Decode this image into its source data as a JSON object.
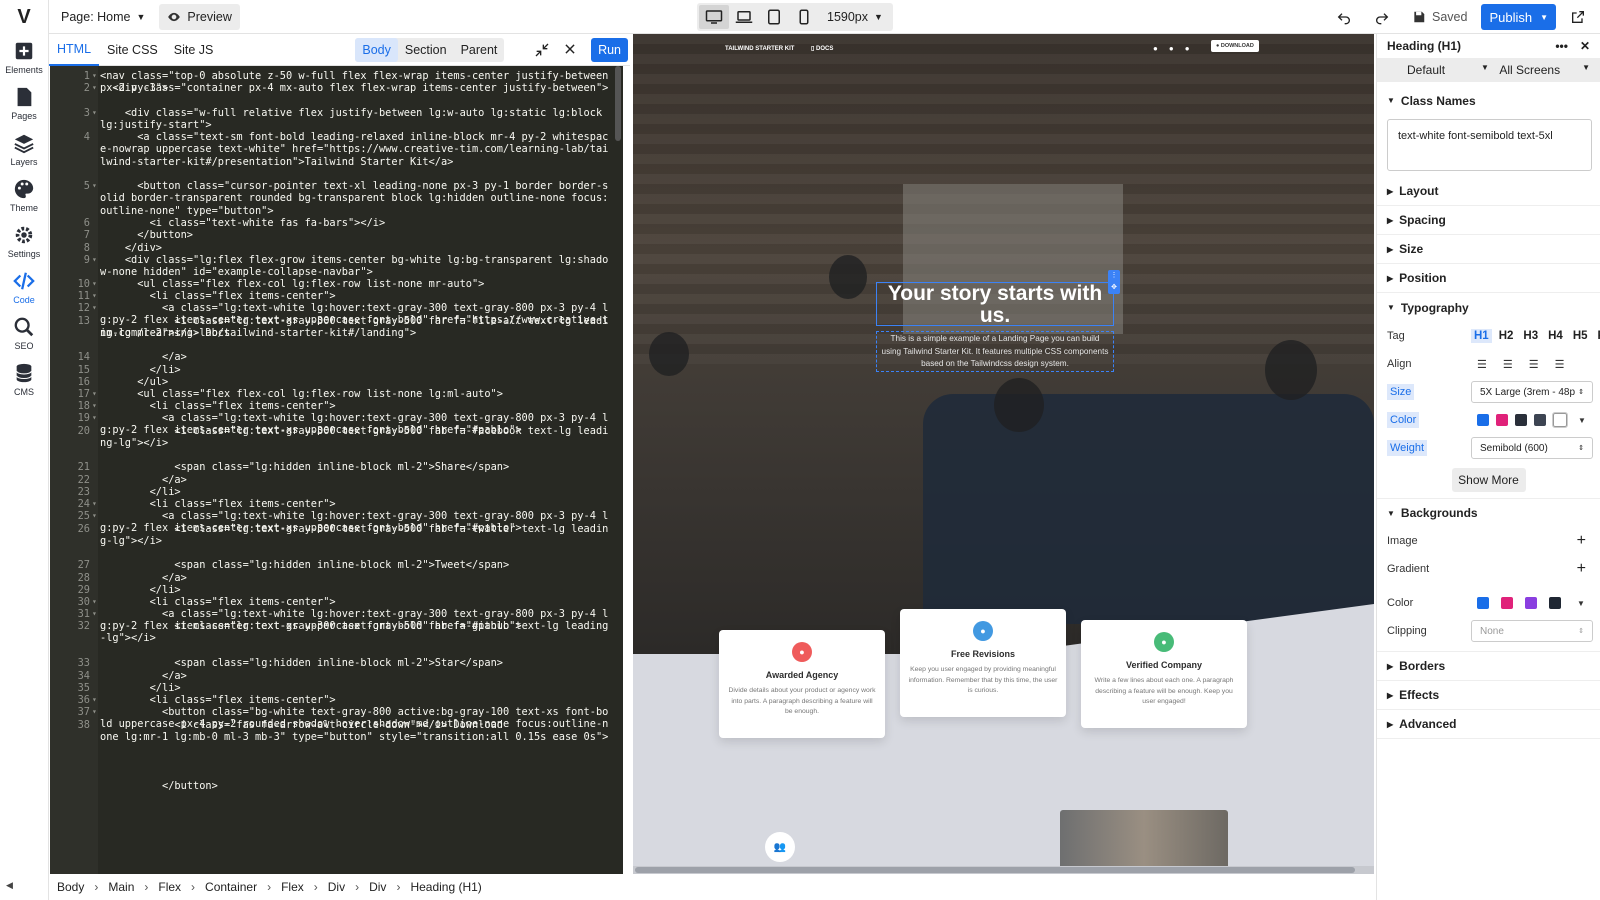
{
  "app": {
    "logo": "V"
  },
  "rail": [
    {
      "label": "Elements",
      "icon": "plus-square-icon"
    },
    {
      "label": "Pages",
      "icon": "file-icon"
    },
    {
      "label": "Layers",
      "icon": "layers-icon"
    },
    {
      "label": "Theme",
      "icon": "palette-icon"
    },
    {
      "label": "Settings",
      "icon": "gear-icon"
    },
    {
      "label": "Code",
      "icon": "code-icon",
      "active": true
    },
    {
      "label": "SEO",
      "icon": "search-icon"
    },
    {
      "label": "CMS",
      "icon": "database-icon"
    }
  ],
  "topbar": {
    "page_label": "Page: Home",
    "preview_label": "Preview",
    "width_label": "1590px",
    "saved_label": "Saved",
    "publish_label": "Publish"
  },
  "code_panel": {
    "tabs": [
      "HTML",
      "Site CSS",
      "Site JS"
    ],
    "scope": [
      "Body",
      "Section",
      "Parent"
    ],
    "run_label": "Run"
  },
  "code_lines": [
    {
      "n": "1",
      "f": "▾",
      "t": "<nav class=\"top-0 absolute z-50 w-full flex flex-wrap items-center justify-between px-2 py-3\">"
    },
    {
      "n": "2",
      "f": "▾",
      "t": "  <div class=\"container px-4 mx-auto flex flex-wrap items-center justify-between\">"
    },
    {
      "n": "3",
      "f": "▾",
      "t": "    <div class=\"w-full relative flex justify-between lg:w-auto lg:static lg:block lg:justify-start\">"
    },
    {
      "n": "4",
      "f": "",
      "t": "      <a class=\"text-sm font-bold leading-relaxed inline-block mr-4 py-2 whitespace-nowrap uppercase text-white\" href=\"https://www.creative-tim.com/learning-lab/tailwind-starter-kit#/presentation\">Tailwind Starter Kit</a>"
    },
    {
      "n": "5",
      "f": "▾",
      "t": "      <button class=\"cursor-pointer text-xl leading-none px-3 py-1 border border-solid border-transparent rounded bg-transparent block lg:hidden outline-none focus:outline-none\" type=\"button\">"
    },
    {
      "n": "6",
      "f": "",
      "t": "        <i class=\"text-white fas fa-bars\"></i>"
    },
    {
      "n": "7",
      "f": "",
      "t": "      </button>"
    },
    {
      "n": "8",
      "f": "",
      "t": "    </div>"
    },
    {
      "n": "9",
      "f": "▾",
      "t": "    <div class=\"lg:flex flex-grow items-center bg-white lg:bg-transparent lg:shadow-none hidden\" id=\"example-collapse-navbar\">"
    },
    {
      "n": "10",
      "f": "▾",
      "t": "      <ul class=\"flex flex-col lg:flex-row list-none mr-auto\">"
    },
    {
      "n": "11",
      "f": "▾",
      "t": "        <li class=\"flex items-center\">"
    },
    {
      "n": "12",
      "f": "▾",
      "t": "          <a class=\"lg:text-white lg:hover:text-gray-300 text-gray-800 px-3 py-4 lg:py-2 flex items-center text-xs uppercase font-bold\" href=\"https://www.creative-tim.com/learning-lab/tailwind-starter-kit#/landing\">"
    },
    {
      "n": "13",
      "f": "",
      "t": "            <i class=\"lg:text-gray-300 text-gray-500 far fa-file-alt text-lg leading-lg mr-2\"></i> Docs"
    },
    {
      "n": "14",
      "f": "",
      "t": "          </a>"
    },
    {
      "n": "15",
      "f": "",
      "t": "        </li>"
    },
    {
      "n": "16",
      "f": "",
      "t": "      </ul>"
    },
    {
      "n": "17",
      "f": "▾",
      "t": "      <ul class=\"flex flex-col lg:flex-row list-none lg:ml-auto\">"
    },
    {
      "n": "18",
      "f": "▾",
      "t": "        <li class=\"flex items-center\">"
    },
    {
      "n": "19",
      "f": "▾",
      "t": "          <a class=\"lg:text-white lg:hover:text-gray-300 text-gray-800 px-3 py-4 lg:py-2 flex items-center text-xs uppercase font-bold\" href=\"#pablo\">"
    },
    {
      "n": "20",
      "f": "",
      "t": "            <i class=\"lg:text-gray-300 text-gray-500 fab fa-facebook text-lg leading-lg\"></i>"
    },
    {
      "n": "21",
      "f": "",
      "t": "            <span class=\"lg:hidden inline-block ml-2\">Share</span>"
    },
    {
      "n": "22",
      "f": "",
      "t": "          </a>"
    },
    {
      "n": "23",
      "f": "",
      "t": "        </li>"
    },
    {
      "n": "24",
      "f": "▾",
      "t": "        <li class=\"flex items-center\">"
    },
    {
      "n": "25",
      "f": "▾",
      "t": "          <a class=\"lg:text-white lg:hover:text-gray-300 text-gray-800 px-3 py-4 lg:py-2 flex items-center text-xs uppercase font-bold\" href=\"#pablo\">"
    },
    {
      "n": "26",
      "f": "",
      "t": "            <i class=\"lg:text-gray-300 text-gray-500 fab fa-twitter text-lg leading-lg\"></i>"
    },
    {
      "n": "27",
      "f": "",
      "t": "            <span class=\"lg:hidden inline-block ml-2\">Tweet</span>"
    },
    {
      "n": "28",
      "f": "",
      "t": "          </a>"
    },
    {
      "n": "29",
      "f": "",
      "t": "        </li>"
    },
    {
      "n": "30",
      "f": "▾",
      "t": "        <li class=\"flex items-center\">"
    },
    {
      "n": "31",
      "f": "▾",
      "t": "          <a class=\"lg:text-white lg:hover:text-gray-300 text-gray-800 px-3 py-4 lg:py-2 flex items-center text-xs uppercase font-bold\" href=\"#pablo\">"
    },
    {
      "n": "32",
      "f": "",
      "t": "            <i class=\"lg:text-gray-300 text-gray-500 fab fa-github text-lg leading-lg\"></i>"
    },
    {
      "n": "33",
      "f": "",
      "t": "            <span class=\"lg:hidden inline-block ml-2\">Star</span>"
    },
    {
      "n": "34",
      "f": "",
      "t": "          </a>"
    },
    {
      "n": "35",
      "f": "",
      "t": "        </li>"
    },
    {
      "n": "36",
      "f": "▾",
      "t": "        <li class=\"flex items-center\">"
    },
    {
      "n": "37",
      "f": "▾",
      "t": "          <button class=\"bg-white text-gray-800 active:bg-gray-100 text-xs font-bold uppercase px-4 py-2 rounded shadow hover:shadow-md outline-none focus:outline-none lg:mr-1 lg:mb-0 ml-3 mb-3\" type=\"button\" style=\"transition:all 0.15s ease 0s\">"
    },
    {
      "n": "38",
      "f": "",
      "t": "            <i class=\"fas fa-arrow-alt-circle-down\"></i> Download"
    },
    {
      "n": "",
      "f": "",
      "t": "          </button>"
    }
  ],
  "preview": {
    "brand": "Tailwind Starter Kit",
    "docs": "Docs",
    "download": "Download",
    "heading": "Your story starts with us.",
    "paragraph": "This is a simple example of a Landing Page you can build using Tailwind Starter Kit. It features multiple CSS components based on the Tailwindcss design system.",
    "cards": [
      {
        "title": "Awarded Agency",
        "desc": "Divide details about your product or agency work into parts. A paragraph describing a feature will be enough.",
        "color": "#ef5b5b",
        "icon": "award-icon"
      },
      {
        "title": "Free Revisions",
        "desc": "Keep you user engaged by providing meaningful information. Remember that by this time, the user is curious.",
        "color": "#4299e1",
        "icon": "retweet-icon"
      },
      {
        "title": "Verified Company",
        "desc": "Write a few lines about each one. A paragraph describing a feature will be enough. Keep you user engaged!",
        "color": "#48bb78",
        "icon": "fingerprint-icon"
      }
    ]
  },
  "inspector": {
    "title": "Heading (H1)",
    "state": "Default",
    "screens": "All Screens",
    "class_names_label": "Class Names",
    "class_names": "text-white font-semibold text-5xl",
    "sections": [
      "Layout",
      "Spacing",
      "Size",
      "Position"
    ],
    "typography_label": "Typography",
    "tag_label": "Tag",
    "tags": [
      "H1",
      "H2",
      "H3",
      "H4",
      "H5",
      "P"
    ],
    "align_label": "Align",
    "size_label": "Size",
    "size_value": "5X Large (3rem - 48p",
    "color_label": "Color",
    "weight_label": "Weight",
    "weight_value": "Semibold (600)",
    "show_more": "Show More",
    "text_colors": [
      "#1a6ee8",
      "#e0227a",
      "#2a2f3a",
      "#3d4452",
      "#ffffff"
    ],
    "backgrounds_label": "Backgrounds",
    "image_label": "Image",
    "gradient_label": "Gradient",
    "bg_color_label": "Color",
    "bg_colors": [
      "#1a6ee8",
      "#e0227a",
      "#8a3ee0",
      "#1f2733"
    ],
    "clipping_label": "Clipping",
    "clipping_value": "None",
    "tail_sections": [
      "Borders",
      "Effects",
      "Advanced"
    ]
  },
  "breadcrumb": [
    "Body",
    "Main",
    "Flex",
    "Container",
    "Flex",
    "Div",
    "Div",
    "Heading (H1)"
  ]
}
